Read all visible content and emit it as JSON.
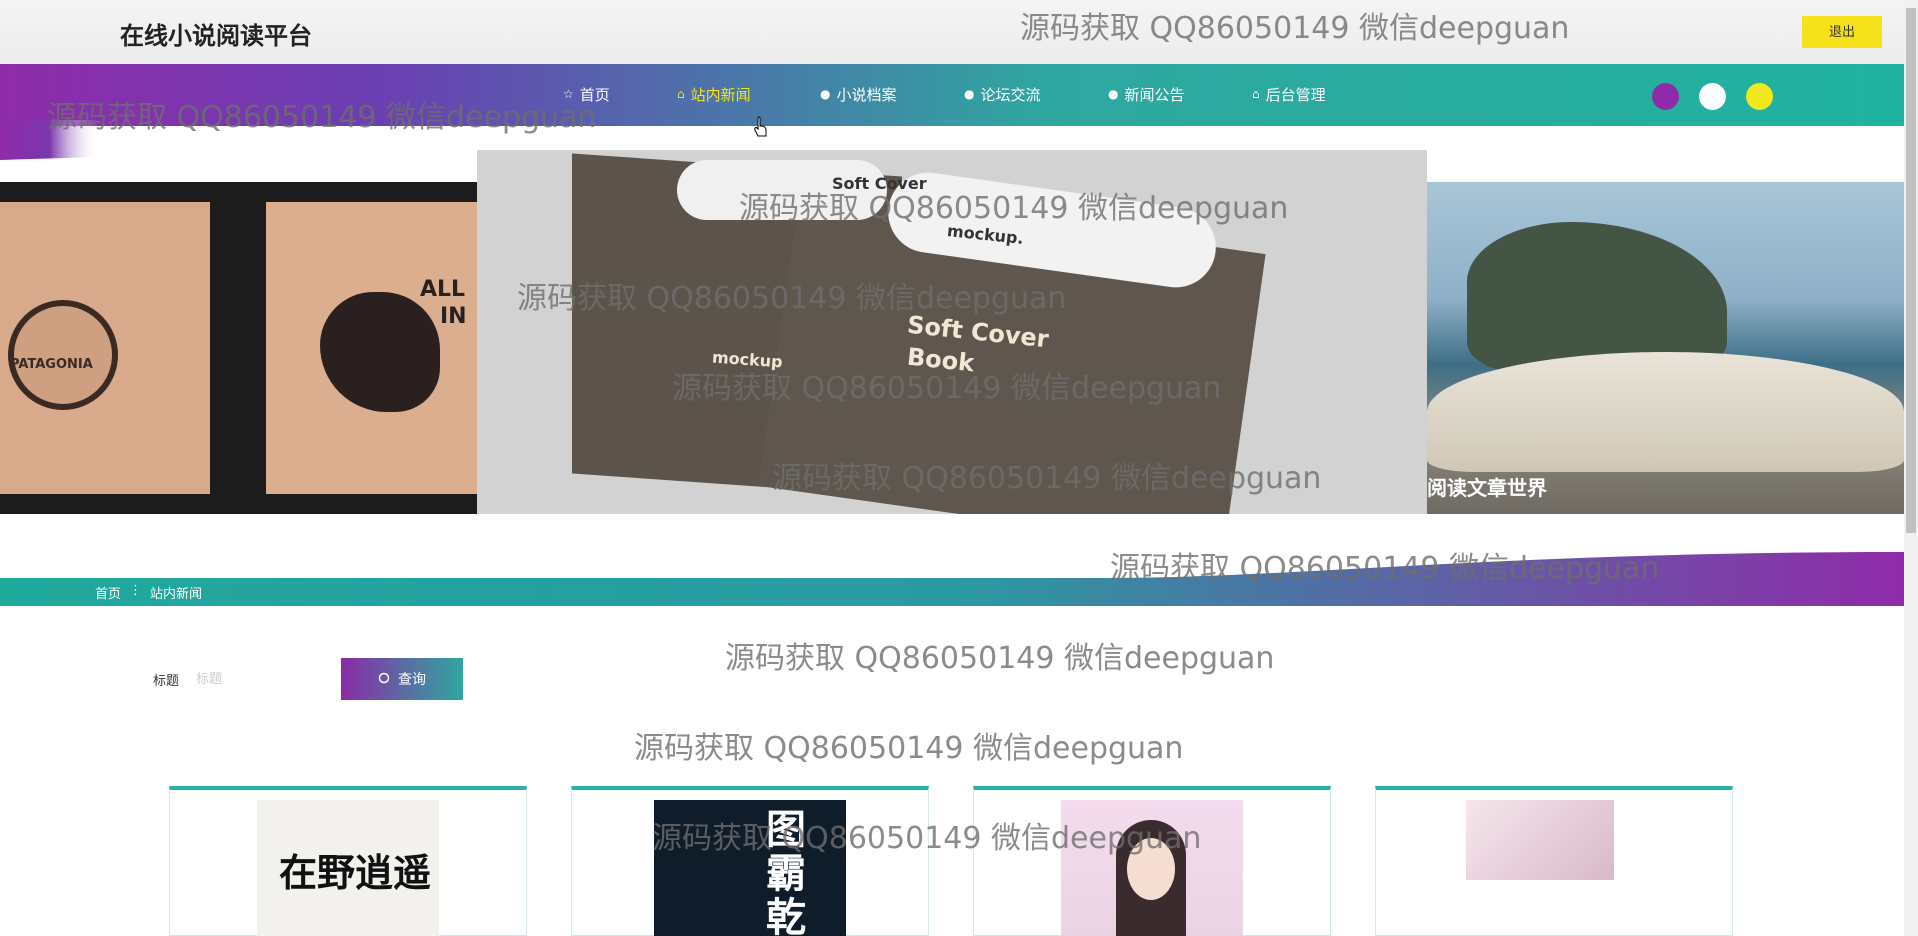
{
  "header": {
    "site_title": "在线小说阅读平台",
    "logout_label": "退出"
  },
  "nav": {
    "items": [
      {
        "label": "首页",
        "icon": "star-icon",
        "glyph": "☆"
      },
      {
        "label": "站内新闻",
        "icon": "bag-icon",
        "glyph": "⌂"
      },
      {
        "label": "小说档案",
        "icon": "info-icon",
        "glyph": "●"
      },
      {
        "label": "论坛交流",
        "icon": "info-icon",
        "glyph": "●"
      },
      {
        "label": "新闻公告",
        "icon": "info-icon",
        "glyph": "●"
      },
      {
        "label": "后台管理",
        "icon": "briefcase-icon",
        "glyph": "⌂"
      }
    ],
    "active_index": 1,
    "theme_dots": [
      "#8f2ba9",
      "#ffffff",
      "#f3e61a"
    ]
  },
  "banner": {
    "center_texts": [
      "Soft Cover",
      "mockup.",
      "Soft Cover",
      "Book",
      "mockup"
    ],
    "left_texts": [
      "PATAGONIA",
      "ALL",
      "IN"
    ],
    "right_caption": "阅读文章世界"
  },
  "breadcrumb": {
    "home": "首页",
    "separator": "⋮",
    "current": "站内新闻"
  },
  "search": {
    "label": "标题",
    "placeholder": "标题",
    "button_label": "查询"
  },
  "cards": [
    {
      "cover_text": "在野逍遥"
    },
    {
      "cover_text": "图霸乾"
    },
    {
      "cover_text": ""
    },
    {
      "cover_text": ""
    }
  ],
  "watermark": "源码获取 QQ86050149 微信deepguan",
  "colors": {
    "purple": "#8f2ba9",
    "teal": "#20b2a0",
    "yellow": "#f3e61a"
  }
}
